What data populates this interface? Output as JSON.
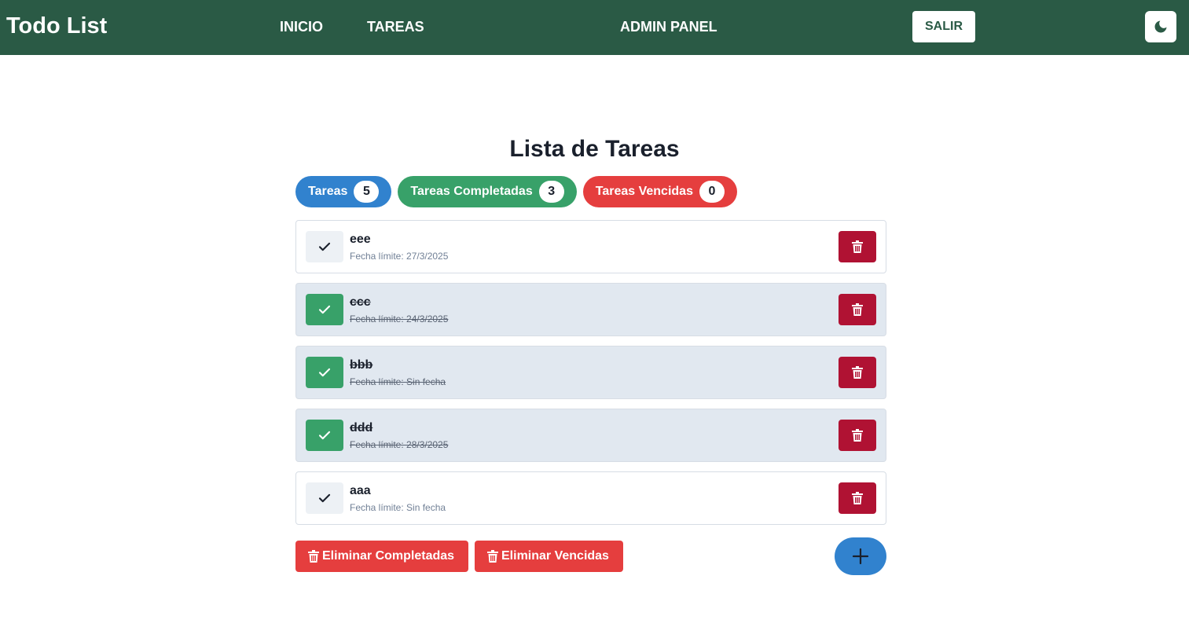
{
  "header": {
    "brand": "Todo List",
    "nav": {
      "inicio": "INICIO",
      "tareas": "TAREAS",
      "admin": "ADMIN PANEL"
    },
    "logout_label": "SALIR",
    "theme_icon": "moon-icon"
  },
  "main": {
    "title": "Lista de Tareas",
    "counters": [
      {
        "label": "Tareas",
        "count": "5",
        "color": "#3182ce"
      },
      {
        "label": "Tareas Completadas",
        "count": "3",
        "color": "#38a169"
      },
      {
        "label": "Tareas Vencidas",
        "count": "0",
        "color": "#e53e3e"
      }
    ],
    "tasks": [
      {
        "name": "eee",
        "due": "Fecha límite: 27/3/2025",
        "completed": false
      },
      {
        "name": "ccc",
        "due": "Fecha límite: 24/3/2025",
        "completed": true
      },
      {
        "name": "bbb",
        "due": "Fecha límite: Sin fecha",
        "completed": true
      },
      {
        "name": "ddd",
        "due": "Fecha límite: 28/3/2025",
        "completed": true
      },
      {
        "name": "aaa",
        "due": "Fecha límite: Sin fecha",
        "completed": false
      }
    ],
    "actions": {
      "delete_completed": "Eliminar Completadas",
      "delete_overdue": "Eliminar Vencidas",
      "add_icon": "plus-icon"
    }
  },
  "colors": {
    "header_bg": "#2a5a45",
    "delete_bg": "#b01233",
    "danger": "#e53e3e",
    "success": "#38a169",
    "primary": "#3182ce"
  }
}
